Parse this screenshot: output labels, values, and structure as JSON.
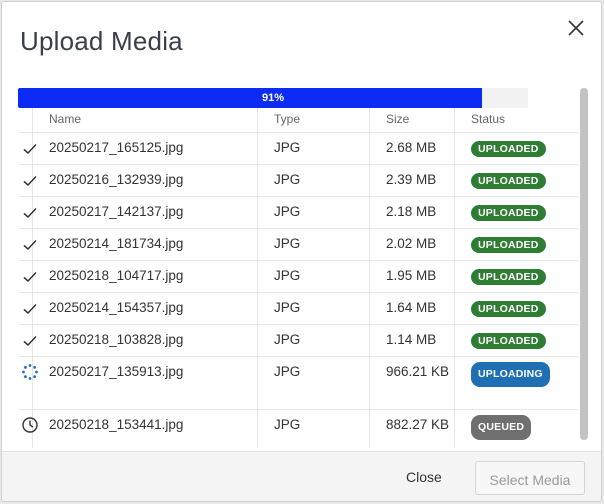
{
  "dialog": {
    "title": "Upload Media"
  },
  "progress": {
    "percent": 0.91,
    "label": "91%",
    "color": "#0c2bf5"
  },
  "table": {
    "headers": {
      "name": "Name",
      "type": "Type",
      "size": "Size",
      "status": "Status"
    },
    "rows": [
      {
        "icon": "checkmark-icon",
        "name": "20250217_165125.jpg",
        "type": "JPG",
        "size": "2.68 MB",
        "status": "UPLOADED"
      },
      {
        "icon": "checkmark-icon",
        "name": "20250216_132939.jpg",
        "type": "JPG",
        "size": "2.39 MB",
        "status": "UPLOADED"
      },
      {
        "icon": "checkmark-icon",
        "name": "20250217_142137.jpg",
        "type": "JPG",
        "size": "2.18 MB",
        "status": "UPLOADED"
      },
      {
        "icon": "checkmark-icon",
        "name": "20250214_181734.jpg",
        "type": "JPG",
        "size": "2.02 MB",
        "status": "UPLOADED"
      },
      {
        "icon": "checkmark-icon",
        "name": "20250218_104717.jpg",
        "type": "JPG",
        "size": "1.95 MB",
        "status": "UPLOADED"
      },
      {
        "icon": "checkmark-icon",
        "name": "20250214_154357.jpg",
        "type": "JPG",
        "size": "1.64 MB",
        "status": "UPLOADED"
      },
      {
        "icon": "checkmark-icon",
        "name": "20250218_103828.jpg",
        "type": "JPG",
        "size": "1.14 MB",
        "status": "UPLOADED"
      },
      {
        "icon": "spinner-icon",
        "name": "20250217_135913.jpg",
        "type": "JPG",
        "size": "966.21 KB",
        "status": "UPLOADING"
      },
      {
        "icon": "clock-icon",
        "name": "20250218_153441.jpg",
        "type": "JPG",
        "size": "882.27 KB",
        "status": "QUEUED"
      }
    ]
  },
  "status_colors": {
    "UPLOADED": "#2e7d32",
    "UPLOADING": "#1f6fb5",
    "QUEUED": "#6f6f6f"
  },
  "footer": {
    "close_label": "Close",
    "select_label": "Select Media"
  }
}
